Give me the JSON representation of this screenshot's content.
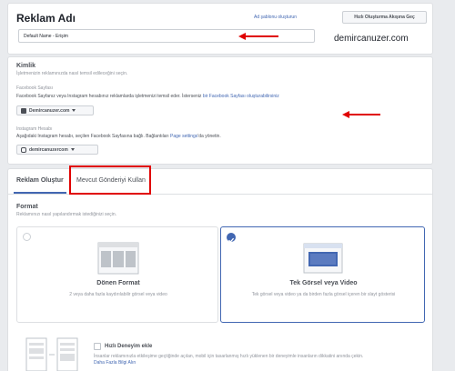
{
  "ad_name": {
    "title": "Reklam Adı",
    "template_link": "Ad şablonu oluşturun",
    "quick_flow_button": "Hızlı Oluşturma Akışına Geç",
    "input_value": "Default Name - Erişim",
    "watermark": "demircanuzer.com"
  },
  "identity": {
    "title": "Kimlik",
    "subtitle": "İşletmenizin reklamınızda nasıl temsil edileceğini seçin.",
    "fb_page_label": "Facebook Sayfası",
    "fb_page_desc": "Facebook Sayfanız veya Instagram hesabınız reklamlarda işletmenizi temsil eder. İsterseniz",
    "fb_page_link": "bir Facebook Sayfası oluşturabilirsiniz",
    "fb_page_value": "Demircanuzer.com",
    "ig_label": "Instagram Hesabı",
    "ig_desc": "Aşağıdaki Instagram hesabı, seçilen Facebook Sayfasına bağlı. Bağlantıları",
    "ig_link": "Page settings",
    "ig_desc_after": "'da yönetin.",
    "ig_value": "demircanuzercom"
  },
  "tabs": {
    "create": "Reklam Oluştur",
    "existing": "Mevcut Gönderiyi Kullan"
  },
  "format": {
    "title": "Format",
    "subtitle": "Reklamınızı nasıl yapılandırmak istediğinizi seçin.",
    "carousel_title": "Dönen Format",
    "carousel_desc": "2 veya daha fazla kaydırılabilir görsel veya video",
    "single_title": "Tek Görsel veya Video",
    "single_desc": "Tek görsel veya video ya da birden fazla görsel içeren bir slayt gösterisi",
    "instant_title": "Hızlı Deneyim ekle",
    "instant_desc": "İnsanlar reklamınızla etkileşime geçtiğinde açılan, mobil için tasarlanmış hızlı yüklenen bir deneyimle insanların dikkatini anında çekin.",
    "instant_link": "Daha Fazla Bilgi Alın"
  },
  "colors": {
    "accent": "#4267b2",
    "annotation_red": "#e00000"
  }
}
